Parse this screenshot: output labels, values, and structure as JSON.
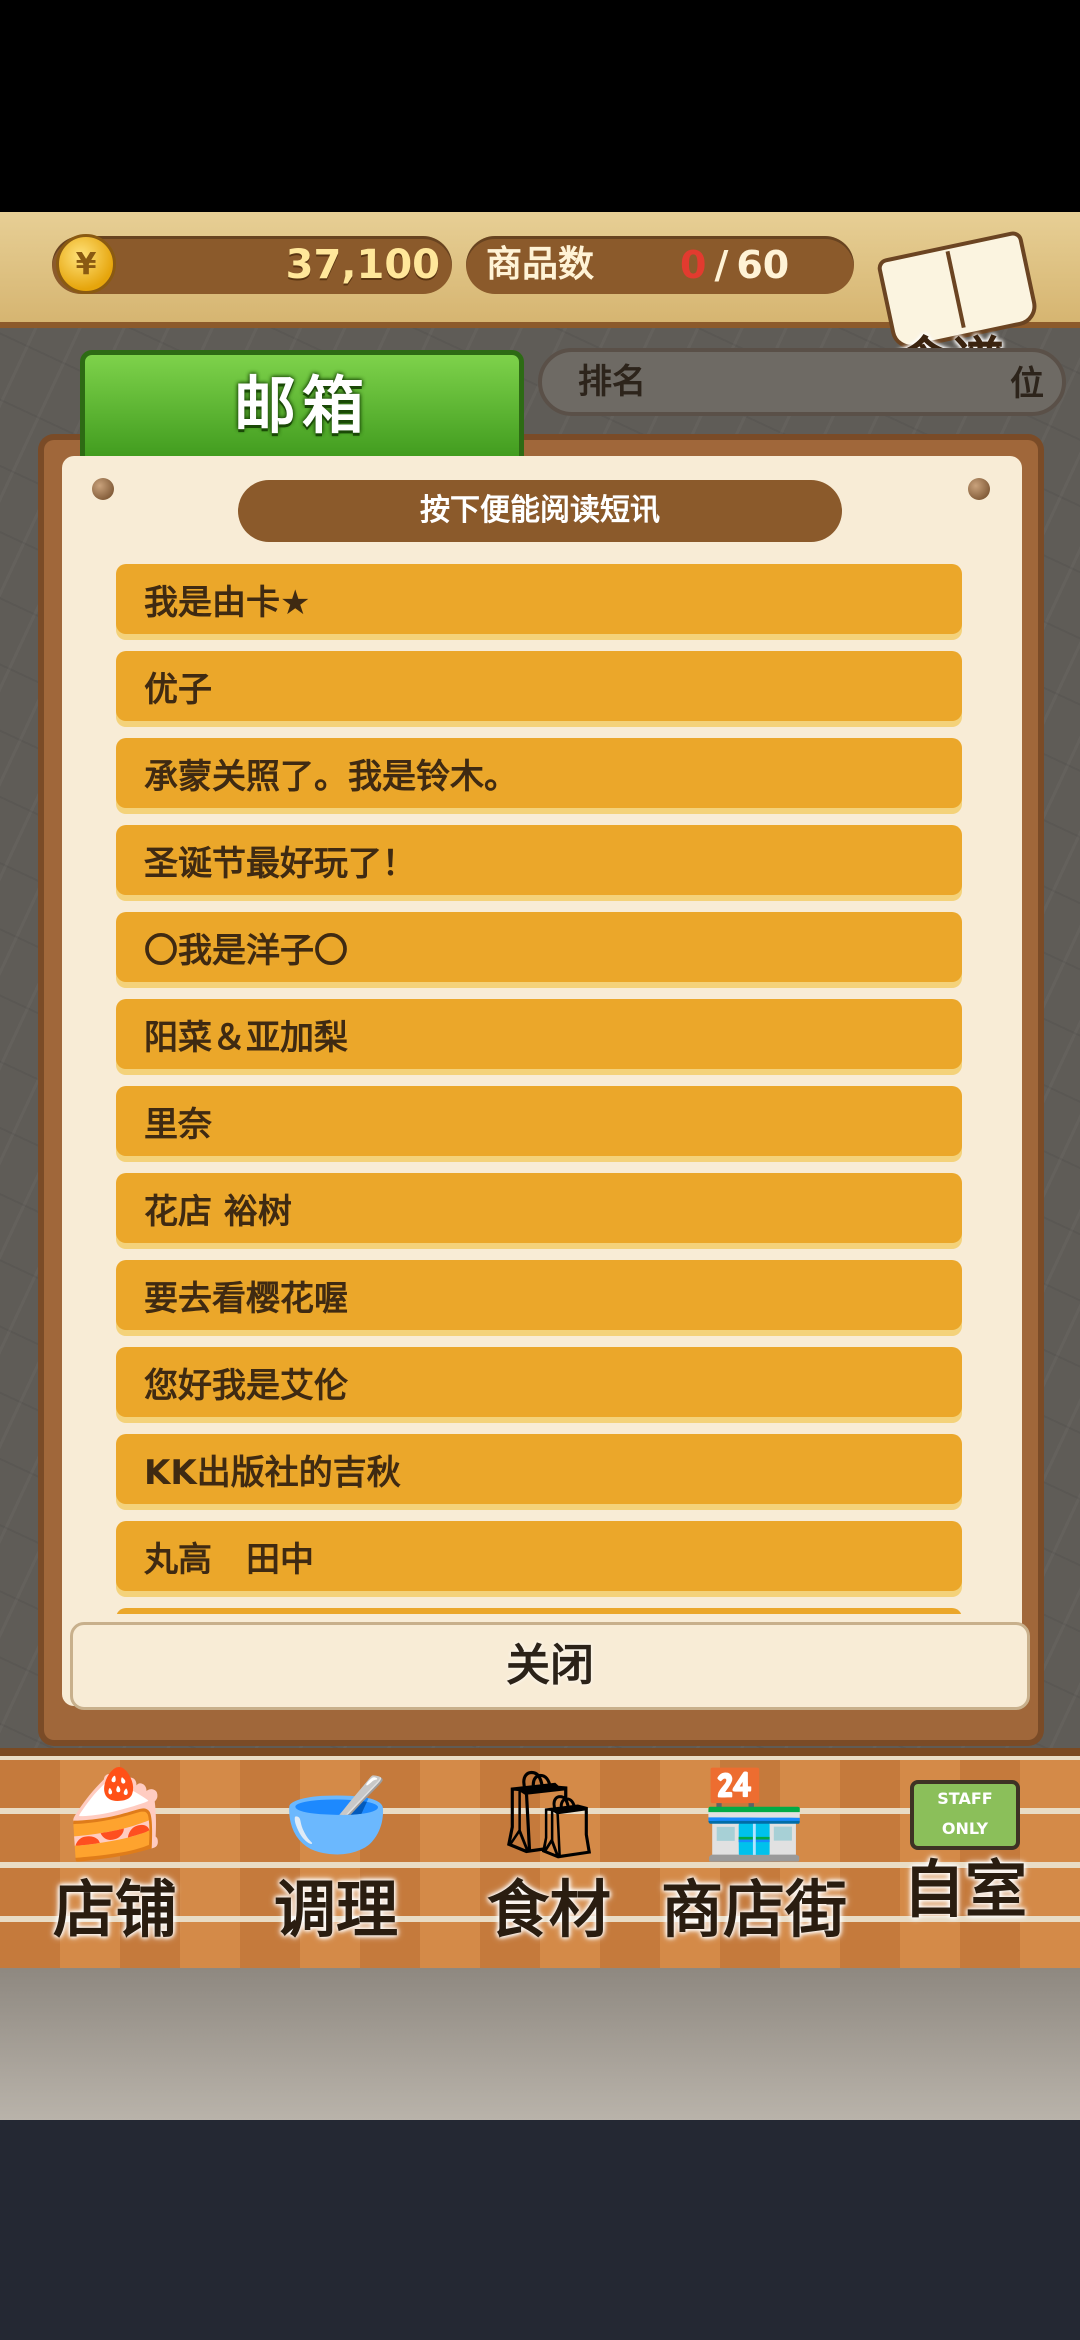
{
  "status": {
    "coin_symbol": "¥",
    "coins": "37,100",
    "goods_label": "商品数",
    "goods_current": "0",
    "goods_separator": "/",
    "goods_max": "60"
  },
  "recipe": {
    "label": "食谱"
  },
  "rank": {
    "label": "排名",
    "unit": "位"
  },
  "mailbox": {
    "title": "邮箱",
    "header": "按下便能阅读短讯",
    "messages": [
      "我是由卡★",
      "优子",
      "承蒙关照了。我是铃木。",
      "圣诞节最好玩了！",
      "〇我是洋子〇",
      "阳菜＆亚加梨",
      "里奈",
      "花店 裕树",
      "要去看樱花喔",
      "您好我是艾伦",
      "KK出版社的吉秋",
      "丸高　田中"
    ],
    "close_label": "关闭"
  },
  "nav": {
    "items": [
      {
        "label": "店铺",
        "icon": "cake-icon"
      },
      {
        "label": "调理",
        "icon": "mixing-bowl-icon"
      },
      {
        "label": "食材",
        "icon": "flour-sack-icon"
      },
      {
        "label": "商店街",
        "icon": "shop-street-icon"
      },
      {
        "label": "自室",
        "icon": "staff-only-sign-icon",
        "sign_text": "STAFF ONLY"
      }
    ]
  },
  "colors": {
    "accent_green": "#4caf24",
    "message_item": "#eba72a",
    "pill_brown": "#8b5a2b",
    "paper": "#f8ecd6",
    "count_red": "#e23b2f"
  }
}
